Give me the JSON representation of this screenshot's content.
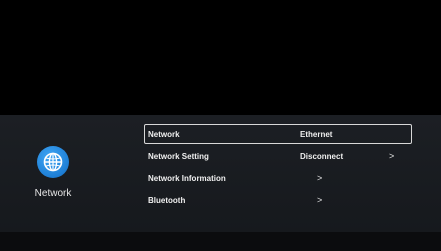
{
  "category": {
    "label": "Network",
    "icon": "globe-icon",
    "icon_color": "#2a8ce8"
  },
  "menu": {
    "items": [
      {
        "label": "Network",
        "value": "Ethernet",
        "chevron": ""
      },
      {
        "label": "Network Setting",
        "value": "Disconnect",
        "chevron": ">"
      },
      {
        "label": "Network Information",
        "value": "",
        "chevron": ">"
      },
      {
        "label": "Bluetooth",
        "value": "",
        "chevron": ">"
      }
    ],
    "selected_index": 0
  }
}
